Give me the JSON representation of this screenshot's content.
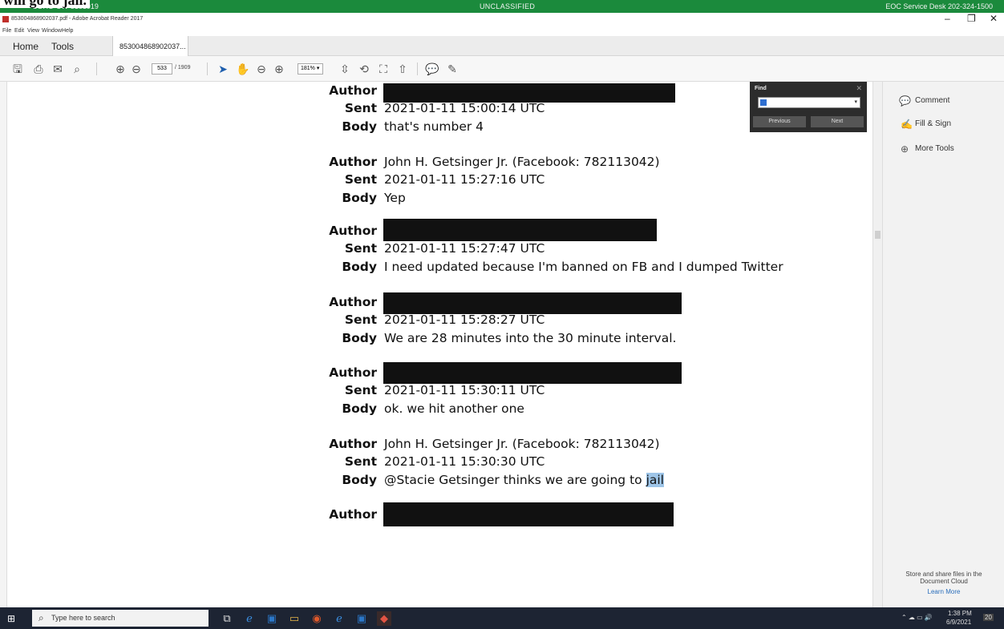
{
  "banner": {
    "overlay_text": "will go to jail.",
    "left": "COHO-UW-5181919",
    "center": "UNCLASSIFIED",
    "right": "EOC Service Desk 202-324-1500"
  },
  "window": {
    "title": "853004868902037.pdf - Adobe Acrobat Reader 2017",
    "menu": [
      "File",
      "Edit",
      "View",
      "Window",
      "Help"
    ],
    "controls": {
      "minimize": "–",
      "maximize": "❐",
      "close": "✕"
    }
  },
  "tabs": {
    "home": "Home",
    "tools": "Tools",
    "doc": "853004868902037... ×"
  },
  "toolbar": {
    "page_current": "533",
    "page_total": "/ 1909",
    "zoom": "181% ▾"
  },
  "find": {
    "title": "Find",
    "close": "✕",
    "dropdown_arrow": "▾",
    "previous": "Previous",
    "next": "Next"
  },
  "messages": [
    {
      "author": null,
      "sent": "2021-01-11 15:00:14 UTC",
      "body": "that's number 4"
    },
    {
      "author": "John H. Getsinger Jr. (Facebook: 782113042)",
      "sent": "2021-01-11 15:27:16 UTC",
      "body": "Yep"
    },
    {
      "author": null,
      "sent": "2021-01-11 15:27:47 UTC",
      "body": "I need updated because I'm banned on FB and I dumped Twitter"
    },
    {
      "author": null,
      "sent": "2021-01-11 15:28:27 UTC",
      "body": "We are 28 minutes into the 30 minute interval."
    },
    {
      "author": null,
      "sent": "2021-01-11 15:30:11 UTC",
      "body": "ok. we hit another one"
    },
    {
      "author": "John H. Getsinger Jr. (Facebook: 782113042)",
      "sent": "2021-01-11 15:30:30 UTC",
      "body_prefix": "@Stacie Getsinger thinks we are going to ",
      "body_highlight": "jail"
    },
    {
      "author": null
    }
  ],
  "labels": {
    "author": "Author",
    "sent": "Sent",
    "body": "Body"
  },
  "right_panel": {
    "comment": "Comment",
    "fill_sign": "Fill & Sign",
    "more_tools": "More Tools",
    "cloud_text": "Store and share files in the Document Cloud",
    "learn_more": "Learn More"
  },
  "taskbar": {
    "search_placeholder": "Type here to search",
    "time": "1:38 PM",
    "date": "6/9/2021",
    "notifications": "20"
  },
  "colors": {
    "banner_green": "#1b8a3c",
    "taskbar": "#1d2433",
    "highlight": "#9ec5e8",
    "redaction": "#111111"
  }
}
